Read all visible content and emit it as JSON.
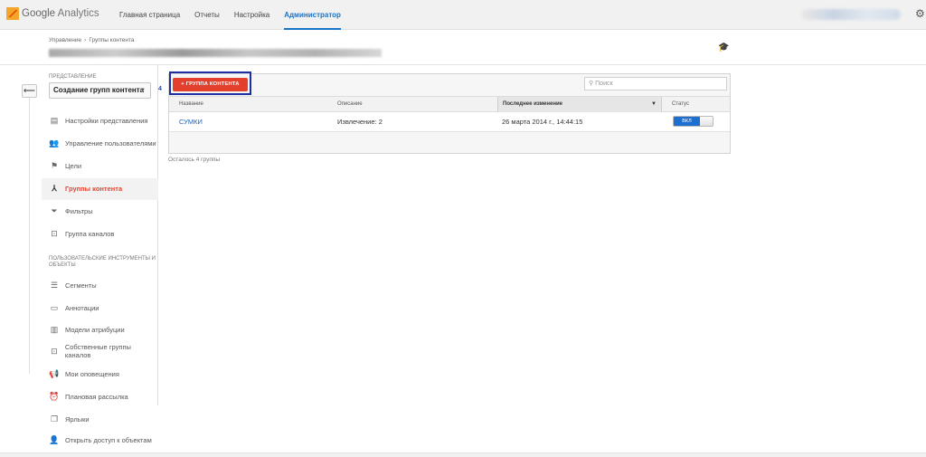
{
  "topbar": {
    "logo_google": "Google",
    "logo_analytics": "Analytics",
    "nav": [
      {
        "label": "Главная страница"
      },
      {
        "label": "Отчеты"
      },
      {
        "label": "Настройка"
      },
      {
        "label": "Администратор"
      }
    ],
    "active_nav": "Администратор"
  },
  "header": {
    "breadcrumb": [
      "Управление",
      "›",
      "Группы контента"
    ]
  },
  "sidebar": {
    "section_view_label": "ПРЕДСТАВЛЕНИЕ",
    "view_select_value": "Создание групп контента",
    "step_number": "4",
    "items": [
      {
        "label": "Настройки представления",
        "icon": "document-icon"
      },
      {
        "label": "Управление пользователями",
        "icon": "users-icon"
      },
      {
        "label": "Цели",
        "icon": "flag-icon"
      },
      {
        "label": "Группы контента",
        "icon": "content-group-icon",
        "active": true
      },
      {
        "label": "Фильтры",
        "icon": "filter-icon"
      },
      {
        "label": "Группа каналов",
        "icon": "channel-group-icon"
      }
    ],
    "section_tools_label": "ПОЛЬЗОВАТЕЛЬСКИЕ ИНСТРУМЕНТЫ И ОБЪЕКТЫ",
    "tool_items": [
      {
        "label": "Сегменты",
        "icon": "segments-icon"
      },
      {
        "label": "Аннотации",
        "icon": "annotation-icon"
      },
      {
        "label": "Модели атрибуции",
        "icon": "bar-chart-icon"
      },
      {
        "label": "Собственные группы каналов",
        "icon": "channel-group-icon"
      },
      {
        "label": "Мои оповещения",
        "icon": "megaphone-icon"
      },
      {
        "label": "Плановая рассылка",
        "icon": "alarm-clock-icon"
      },
      {
        "label": "Ярлыки",
        "icon": "shortcut-icon"
      },
      {
        "label": "Открыть доступ к объектам",
        "icon": "share-user-icon"
      }
    ]
  },
  "main": {
    "add_button_label": "+ ГРУППА КОНТЕНТА",
    "search_placeholder": "Поиск",
    "columns": [
      "Название",
      "Описание",
      "Последнее изменение",
      "Статус"
    ],
    "sorted_column": "Последнее изменение",
    "rows": [
      {
        "name": "СУМКИ",
        "description": "Извлечение: 2",
        "modified": "26 марта 2014 г., 14:44:15",
        "status": "ВКЛ"
      }
    ],
    "remaining_text": "Осталось 4 группы"
  }
}
